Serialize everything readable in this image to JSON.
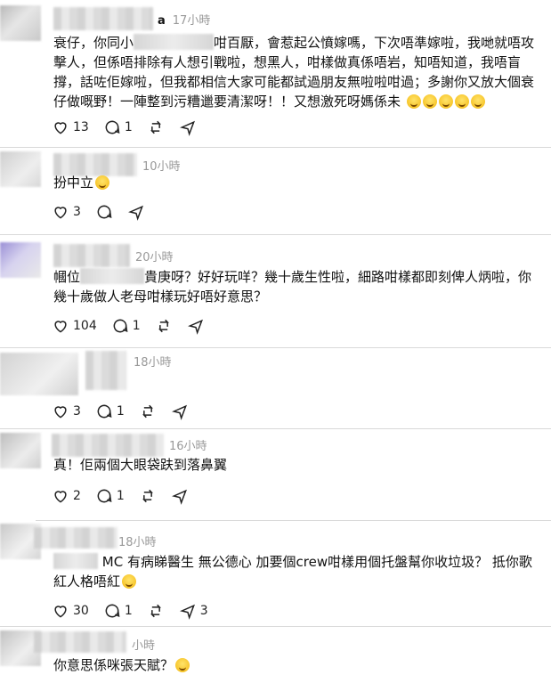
{
  "posts": [
    {
      "name_frag": "a",
      "time": "17小時",
      "body_parts": [
        "衰仔，你同小",
        "咁百厭，會惹起公憤嫁嗎，下次唔準嫁啦，我哋就唔攻擊人，但係唔排除有人想引戰啦，想黑人，咁樣做真係唔岩，知唔知道，我唔盲撐，話咗佢嫁啦，但我都相信大家可能都試過朋友無啦啦咁過；多謝你又放大個衰仔做嘅野！一陣整到污糟邋要清潔呀！！又想激死呀媽係未"
      ],
      "emoji_count": 5,
      "stats": {
        "likes": "13",
        "comments": "1",
        "reposts": "",
        "shares": ""
      }
    },
    {
      "name_frag": "",
      "time": "10小時",
      "body_parts": [
        "扮中立"
      ],
      "emoji_count": 1,
      "stats": {
        "likes": "3",
        "comments": "",
        "reposts": "",
        "shares": ""
      }
    },
    {
      "name_frag": "",
      "time": "20小時",
      "body_parts": [
        "幗位",
        "貴庚呀？好好玩咩？幾十歲生性啦，細路咁樣都即刻俾人炳啦，你幾十歲做人老母咁樣玩好唔好意思？"
      ],
      "emoji_count": 0,
      "stats": {
        "likes": "104",
        "comments": "1",
        "reposts": "",
        "shares": ""
      }
    },
    {
      "name_frag": "",
      "time": "18小時",
      "body_parts": [],
      "emoji_count": 0,
      "stats": {
        "likes": "3",
        "comments": "1",
        "reposts": "",
        "shares": ""
      }
    },
    {
      "name_frag": "",
      "time": "16小時",
      "body_parts": [
        "真！佢兩個大眼袋趺到落鼻翼"
      ],
      "emoji_count": 0,
      "stats": {
        "likes": "2",
        "comments": "1",
        "reposts": "",
        "shares": ""
      }
    },
    {
      "name_frag": "",
      "time": "18小時",
      "body_parts": [
        "MC 有病睇醫生 無公德心 加要個crew咁樣用個托盤幫你收垃圾？ 抵你歌紅人格唔紅"
      ],
      "emoji_count": 1,
      "stats": {
        "likes": "30",
        "comments": "1",
        "reposts": "",
        "shares": "3"
      }
    },
    {
      "name_frag": "",
      "time": "小時",
      "body_parts": [
        "你意思係咪張天賦？"
      ],
      "emoji_count": 1,
      "stats": {
        "likes": "",
        "comments": "",
        "reposts": "",
        "shares": ""
      }
    }
  ],
  "icons": {
    "like": "heart-icon",
    "comment": "comment-icon",
    "repost": "repost-icon",
    "share": "share-icon"
  }
}
